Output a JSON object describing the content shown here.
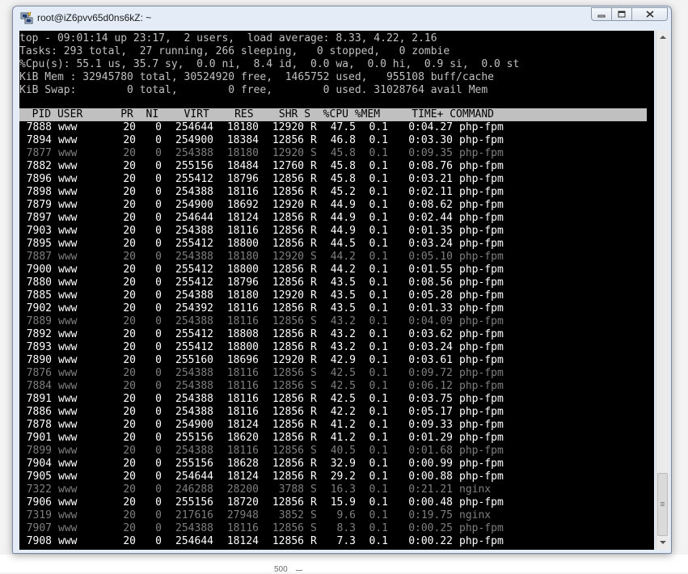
{
  "window": {
    "title": "root@iZ6pvv65d0ns6kZ: ~",
    "icon": "putty-icon",
    "controls": [
      "minimize-icon",
      "maximize-icon",
      "close-icon"
    ]
  },
  "background": {
    "axis_tick": "500"
  },
  "summary": [
    "top - 09:01:14 up 23:17,  2 users,  load average: 8.33, 4.22, 2.16",
    "Tasks: 293 total,  27 running, 266 sleeping,   0 stopped,   0 zombie",
    "%Cpu(s): 55.1 us, 35.7 sy,  0.0 ni,  8.4 id,  0.0 wa,  0.0 hi,  0.9 si,  0.0 st",
    "KiB Mem : 32945780 total, 30524920 free,  1465752 used,   955108 buff/cache",
    "KiB Swap:        0 total,        0 free,        0 used. 31028764 avail Mem"
  ],
  "header": "  PID USER      PR  NI    VIRT    RES    SHR S  %CPU %MEM     TIME+ COMMAND",
  "processes": [
    {
      "pid": "7888",
      "user": "www",
      "pr": "20",
      "ni": "0",
      "virt": "254644",
      "res": "18180",
      "shr": "12920",
      "s": "R",
      "cpu": "47.5",
      "mem": "0.1",
      "time": "0:04.27",
      "cmd": "php-fpm"
    },
    {
      "pid": "7894",
      "user": "www",
      "pr": "20",
      "ni": "0",
      "virt": "254900",
      "res": "18384",
      "shr": "12856",
      "s": "R",
      "cpu": "46.8",
      "mem": "0.1",
      "time": "0:03.30",
      "cmd": "php-fpm"
    },
    {
      "pid": "7877",
      "user": "www",
      "pr": "20",
      "ni": "0",
      "virt": "254388",
      "res": "18180",
      "shr": "12920",
      "s": "S",
      "cpu": "45.8",
      "mem": "0.1",
      "time": "0:09.35",
      "cmd": "php-fpm"
    },
    {
      "pid": "7882",
      "user": "www",
      "pr": "20",
      "ni": "0",
      "virt": "255156",
      "res": "18484",
      "shr": "12760",
      "s": "R",
      "cpu": "45.8",
      "mem": "0.1",
      "time": "0:08.76",
      "cmd": "php-fpm"
    },
    {
      "pid": "7896",
      "user": "www",
      "pr": "20",
      "ni": "0",
      "virt": "255412",
      "res": "18796",
      "shr": "12856",
      "s": "R",
      "cpu": "45.8",
      "mem": "0.1",
      "time": "0:03.21",
      "cmd": "php-fpm"
    },
    {
      "pid": "7898",
      "user": "www",
      "pr": "20",
      "ni": "0",
      "virt": "254388",
      "res": "18116",
      "shr": "12856",
      "s": "R",
      "cpu": "45.2",
      "mem": "0.1",
      "time": "0:02.11",
      "cmd": "php-fpm"
    },
    {
      "pid": "7879",
      "user": "www",
      "pr": "20",
      "ni": "0",
      "virt": "254900",
      "res": "18692",
      "shr": "12920",
      "s": "R",
      "cpu": "44.9",
      "mem": "0.1",
      "time": "0:08.62",
      "cmd": "php-fpm"
    },
    {
      "pid": "7897",
      "user": "www",
      "pr": "20",
      "ni": "0",
      "virt": "254644",
      "res": "18124",
      "shr": "12856",
      "s": "R",
      "cpu": "44.9",
      "mem": "0.1",
      "time": "0:02.44",
      "cmd": "php-fpm"
    },
    {
      "pid": "7903",
      "user": "www",
      "pr": "20",
      "ni": "0",
      "virt": "254388",
      "res": "18116",
      "shr": "12856",
      "s": "R",
      "cpu": "44.9",
      "mem": "0.1",
      "time": "0:01.35",
      "cmd": "php-fpm"
    },
    {
      "pid": "7895",
      "user": "www",
      "pr": "20",
      "ni": "0",
      "virt": "255412",
      "res": "18800",
      "shr": "12856",
      "s": "R",
      "cpu": "44.5",
      "mem": "0.1",
      "time": "0:03.24",
      "cmd": "php-fpm"
    },
    {
      "pid": "7887",
      "user": "www",
      "pr": "20",
      "ni": "0",
      "virt": "254388",
      "res": "18180",
      "shr": "12920",
      "s": "S",
      "cpu": "44.2",
      "mem": "0.1",
      "time": "0:05.10",
      "cmd": "php-fpm"
    },
    {
      "pid": "7900",
      "user": "www",
      "pr": "20",
      "ni": "0",
      "virt": "255412",
      "res": "18800",
      "shr": "12856",
      "s": "R",
      "cpu": "44.2",
      "mem": "0.1",
      "time": "0:01.55",
      "cmd": "php-fpm"
    },
    {
      "pid": "7880",
      "user": "www",
      "pr": "20",
      "ni": "0",
      "virt": "255412",
      "res": "18796",
      "shr": "12856",
      "s": "R",
      "cpu": "43.5",
      "mem": "0.1",
      "time": "0:08.56",
      "cmd": "php-fpm"
    },
    {
      "pid": "7885",
      "user": "www",
      "pr": "20",
      "ni": "0",
      "virt": "254388",
      "res": "18180",
      "shr": "12920",
      "s": "R",
      "cpu": "43.5",
      "mem": "0.1",
      "time": "0:05.28",
      "cmd": "php-fpm"
    },
    {
      "pid": "7902",
      "user": "www",
      "pr": "20",
      "ni": "0",
      "virt": "254392",
      "res": "18116",
      "shr": "12856",
      "s": "R",
      "cpu": "43.5",
      "mem": "0.1",
      "time": "0:01.33",
      "cmd": "php-fpm"
    },
    {
      "pid": "7889",
      "user": "www",
      "pr": "20",
      "ni": "0",
      "virt": "254388",
      "res": "18116",
      "shr": "12856",
      "s": "S",
      "cpu": "43.2",
      "mem": "0.1",
      "time": "0:04.09",
      "cmd": "php-fpm"
    },
    {
      "pid": "7892",
      "user": "www",
      "pr": "20",
      "ni": "0",
      "virt": "255412",
      "res": "18808",
      "shr": "12856",
      "s": "R",
      "cpu": "43.2",
      "mem": "0.1",
      "time": "0:03.62",
      "cmd": "php-fpm"
    },
    {
      "pid": "7893",
      "user": "www",
      "pr": "20",
      "ni": "0",
      "virt": "255412",
      "res": "18800",
      "shr": "12856",
      "s": "R",
      "cpu": "43.2",
      "mem": "0.1",
      "time": "0:03.24",
      "cmd": "php-fpm"
    },
    {
      "pid": "7890",
      "user": "www",
      "pr": "20",
      "ni": "0",
      "virt": "255160",
      "res": "18696",
      "shr": "12920",
      "s": "R",
      "cpu": "42.9",
      "mem": "0.1",
      "time": "0:03.61",
      "cmd": "php-fpm"
    },
    {
      "pid": "7876",
      "user": "www",
      "pr": "20",
      "ni": "0",
      "virt": "254388",
      "res": "18116",
      "shr": "12856",
      "s": "S",
      "cpu": "42.5",
      "mem": "0.1",
      "time": "0:09.72",
      "cmd": "php-fpm"
    },
    {
      "pid": "7884",
      "user": "www",
      "pr": "20",
      "ni": "0",
      "virt": "254388",
      "res": "18116",
      "shr": "12856",
      "s": "S",
      "cpu": "42.5",
      "mem": "0.1",
      "time": "0:06.12",
      "cmd": "php-fpm"
    },
    {
      "pid": "7891",
      "user": "www",
      "pr": "20",
      "ni": "0",
      "virt": "254388",
      "res": "18116",
      "shr": "12856",
      "s": "R",
      "cpu": "42.5",
      "mem": "0.1",
      "time": "0:03.75",
      "cmd": "php-fpm"
    },
    {
      "pid": "7886",
      "user": "www",
      "pr": "20",
      "ni": "0",
      "virt": "254388",
      "res": "18116",
      "shr": "12856",
      "s": "R",
      "cpu": "42.2",
      "mem": "0.1",
      "time": "0:05.17",
      "cmd": "php-fpm"
    },
    {
      "pid": "7878",
      "user": "www",
      "pr": "20",
      "ni": "0",
      "virt": "254900",
      "res": "18124",
      "shr": "12856",
      "s": "R",
      "cpu": "41.2",
      "mem": "0.1",
      "time": "0:09.33",
      "cmd": "php-fpm"
    },
    {
      "pid": "7901",
      "user": "www",
      "pr": "20",
      "ni": "0",
      "virt": "255156",
      "res": "18620",
      "shr": "12856",
      "s": "R",
      "cpu": "41.2",
      "mem": "0.1",
      "time": "0:01.29",
      "cmd": "php-fpm"
    },
    {
      "pid": "7899",
      "user": "www",
      "pr": "20",
      "ni": "0",
      "virt": "254388",
      "res": "18116",
      "shr": "12856",
      "s": "S",
      "cpu": "40.5",
      "mem": "0.1",
      "time": "0:01.68",
      "cmd": "php-fpm"
    },
    {
      "pid": "7904",
      "user": "www",
      "pr": "20",
      "ni": "0",
      "virt": "255156",
      "res": "18628",
      "shr": "12856",
      "s": "R",
      "cpu": "32.9",
      "mem": "0.1",
      "time": "0:00.99",
      "cmd": "php-fpm"
    },
    {
      "pid": "7905",
      "user": "www",
      "pr": "20",
      "ni": "0",
      "virt": "254644",
      "res": "18124",
      "shr": "12856",
      "s": "R",
      "cpu": "29.2",
      "mem": "0.1",
      "time": "0:00.88",
      "cmd": "php-fpm"
    },
    {
      "pid": "7322",
      "user": "www",
      "pr": "20",
      "ni": "0",
      "virt": "246288",
      "res": "28200",
      "shr": "3788",
      "s": "S",
      "cpu": "16.3",
      "mem": "0.1",
      "time": "0:21.21",
      "cmd": "nginx"
    },
    {
      "pid": "7906",
      "user": "www",
      "pr": "20",
      "ni": "0",
      "virt": "255156",
      "res": "18720",
      "shr": "12856",
      "s": "R",
      "cpu": "15.9",
      "mem": "0.1",
      "time": "0:00.48",
      "cmd": "php-fpm"
    },
    {
      "pid": "7319",
      "user": "www",
      "pr": "20",
      "ni": "0",
      "virt": "217616",
      "res": "27948",
      "shr": "3852",
      "s": "S",
      "cpu": "9.6",
      "mem": "0.1",
      "time": "0:19.75",
      "cmd": "nginx"
    },
    {
      "pid": "7907",
      "user": "www",
      "pr": "20",
      "ni": "0",
      "virt": "254388",
      "res": "18116",
      "shr": "12856",
      "s": "S",
      "cpu": "8.3",
      "mem": "0.1",
      "time": "0:00.25",
      "cmd": "php-fpm"
    },
    {
      "pid": "7908",
      "user": "www",
      "pr": "20",
      "ni": "0",
      "virt": "254644",
      "res": "18124",
      "shr": "12856",
      "s": "R",
      "cpu": "7.3",
      "mem": "0.1",
      "time": "0:00.22",
      "cmd": "php-fpm"
    }
  ],
  "colors": {
    "terminal_bg": "#000000",
    "running_text": "#ffffff",
    "sleeping_text": "#7f7f7f",
    "summary_text": "#c0c0c0",
    "header_bg": "#c0c0c0"
  }
}
